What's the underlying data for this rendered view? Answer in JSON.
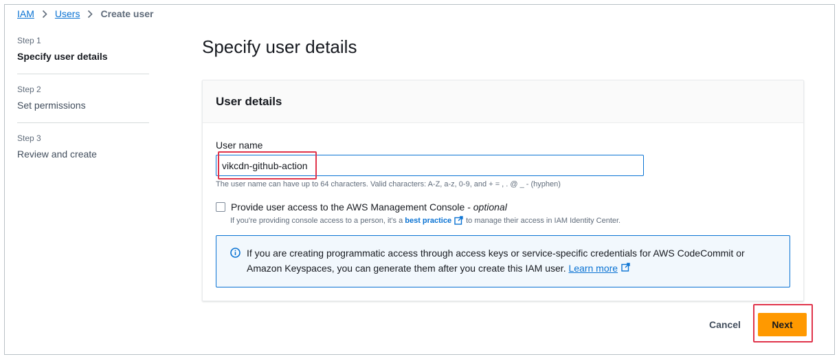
{
  "breadcrumb": {
    "items": [
      "IAM",
      "Users"
    ],
    "current": "Create user"
  },
  "steps": [
    {
      "number": "Step 1",
      "title": "Specify user details"
    },
    {
      "number": "Step 2",
      "title": "Set permissions"
    },
    {
      "number": "Step 3",
      "title": "Review and create"
    }
  ],
  "page_title": "Specify user details",
  "user_details": {
    "title": "User details",
    "username_label": "User name",
    "username_value": "vikcdn-github-action",
    "username_hint": "The user name can have up to 64 characters. Valid characters: A-Z, a-z, 0-9, and + = , . @ _ - (hyphen)",
    "console_access": {
      "label": "Provide user access to the AWS Management Console - ",
      "optional": "optional",
      "checked": false,
      "hint_before": "If you're providing console access to a person, it's a",
      "hint_link": "best practice",
      "hint_after": "to manage their access in IAM Identity Center."
    },
    "info": {
      "text": "If you are creating programmatic access through access keys or service-specific credentials for AWS CodeCommit or Amazon Keyspaces, you can generate them after you create this IAM user.",
      "link": "Learn more"
    }
  },
  "actions": {
    "cancel": "Cancel",
    "next": "Next"
  },
  "colors": {
    "link": "#0972d3",
    "primary_button": "#ff9900",
    "highlight": "#e0334a",
    "info_bg": "#f2f8fd"
  }
}
